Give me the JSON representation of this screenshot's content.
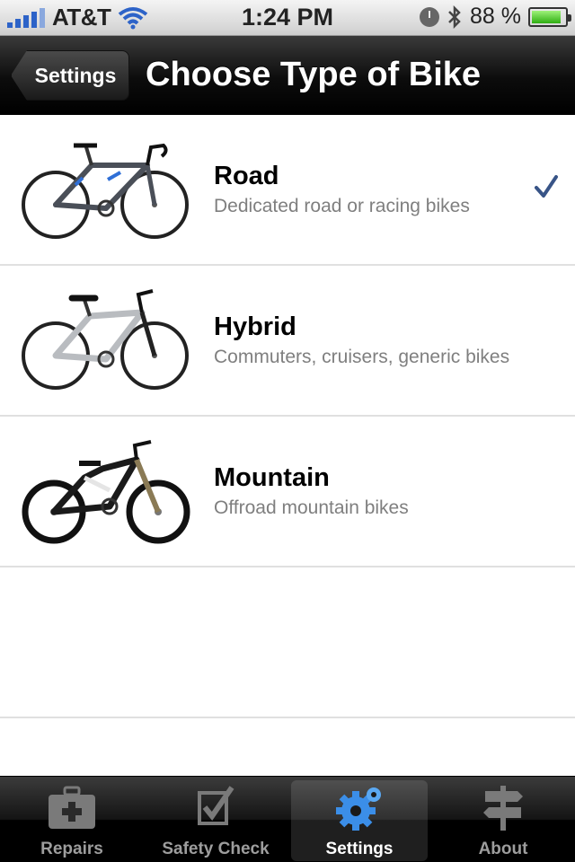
{
  "status_bar": {
    "carrier": "AT&T",
    "time": "1:24 PM",
    "battery_percent": "88 %",
    "battery_level": 0.88
  },
  "nav": {
    "back_label": "Settings",
    "title": "Choose Type of Bike"
  },
  "bike_types": [
    {
      "title": "Road",
      "subtitle": "Dedicated road or racing bikes",
      "selected": true
    },
    {
      "title": "Hybrid",
      "subtitle": "Commuters, cruisers, generic bikes",
      "selected": false
    },
    {
      "title": "Mountain",
      "subtitle": "Offroad mountain bikes",
      "selected": false
    }
  ],
  "tabs": [
    {
      "label": "Repairs",
      "icon": "first-aid-kit-icon"
    },
    {
      "label": "Safety Check",
      "icon": "checkbox-icon"
    },
    {
      "label": "Settings",
      "icon": "gear-icon",
      "active": true
    },
    {
      "label": "About",
      "icon": "signpost-icon"
    }
  ],
  "colors": {
    "accent": "#2f6fd6",
    "check": "#385487"
  }
}
